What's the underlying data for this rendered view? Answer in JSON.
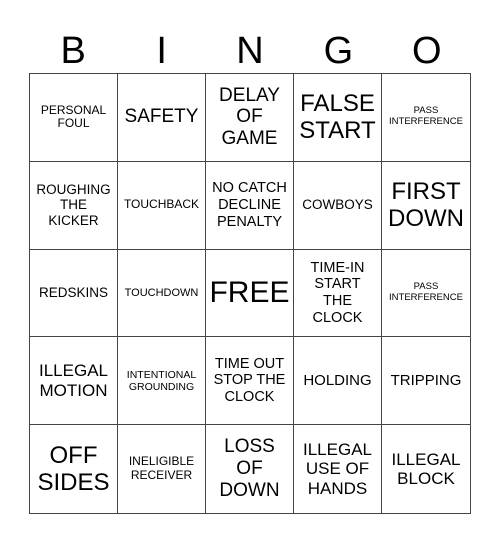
{
  "header": [
    "B",
    "I",
    "N",
    "G",
    "O"
  ],
  "cells": [
    [
      "PERSONAL FOUL",
      "SAFETY",
      "DELAY OF GAME",
      "FALSE START",
      "PASS INTERFERENCE"
    ],
    [
      "ROUGHING THE KICKER",
      "TOUCHBACK",
      "NO CATCH DECLINE PENALTY",
      "COWBOYS",
      "FIRST DOWN"
    ],
    [
      "REDSKINS",
      "TOUCHDOWN",
      "FREE",
      "TIME-IN START THE CLOCK",
      "PASS INTERFERENCE"
    ],
    [
      "ILLEGAL MOTION",
      "INTENTIONAL GROUNDING",
      "TIME OUT STOP THE CLOCK",
      "HOLDING",
      "TRIPPING"
    ],
    [
      "OFF SIDES",
      "INELIGIBLE RECEIVER",
      "LOSS OF DOWN",
      "ILLEGAL USE OF HANDS",
      "ILLEGAL BLOCK"
    ]
  ]
}
